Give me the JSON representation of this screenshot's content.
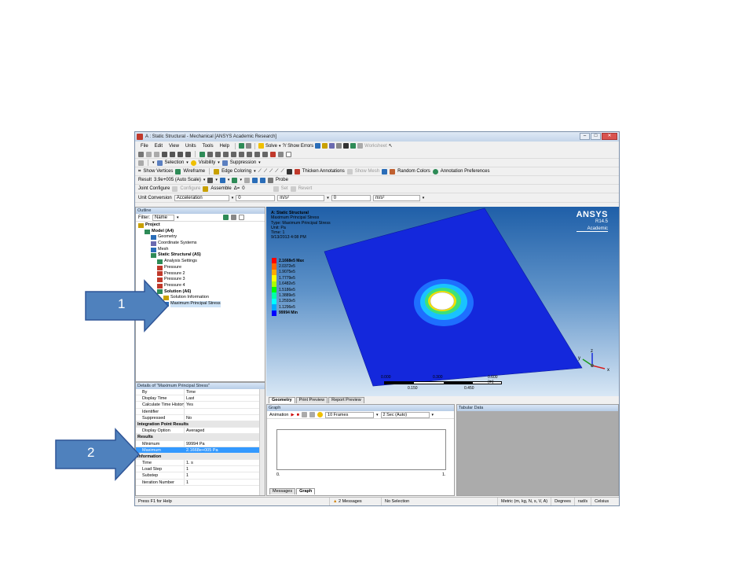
{
  "window": {
    "title": "A : Static Structural - Mechanical [ANSYS Academic Research]",
    "min": "–",
    "max": "□",
    "close": "✕"
  },
  "menu": [
    "File",
    "Edit",
    "View",
    "Units",
    "Tools",
    "Help"
  ],
  "toolbar1": {
    "solve": "Solve",
    "show_errors": "?/ Show Errors",
    "worksheet": "Worksheet"
  },
  "toolbar3": {
    "selection": "Selection",
    "visibility": "Visibility",
    "suppression": "Suppression"
  },
  "toolbar4": {
    "show_vertices": "Show Vertices",
    "wireframe": "Wireframe",
    "edge_coloring": "Edge Coloring",
    "thicken": "Thicken Annotations",
    "show_mesh": "Show Mesh",
    "random_colors": "Random Colors",
    "annotation_prefs": "Annotation Preferences"
  },
  "toolbar5": {
    "result_label": "Result",
    "result_scale": "3.9e+005 (Auto Scale)",
    "probe": "Probe"
  },
  "toolbar6": {
    "joint_configure": "Joint Configure",
    "configure": "Configure",
    "assemble": "Assemble",
    "set": "Set",
    "revert": "Revert",
    "zero": "0"
  },
  "toolbar7": {
    "unit_conversion": "Unit Conversion",
    "quantity": "Acceleration",
    "value1": "0",
    "unit1": "m/s²",
    "value2": "0",
    "unit2": "m/s²"
  },
  "outline": {
    "title": "Outline",
    "filter_label": "Filter:",
    "filter_value": "Name",
    "tree": [
      {
        "label": "Project",
        "level": 0,
        "bold": true,
        "icon": "project-icon"
      },
      {
        "label": "Model (A4)",
        "level": 1,
        "bold": true,
        "icon": "model-icon"
      },
      {
        "label": "Geometry",
        "level": 2,
        "bold": false,
        "icon": "geometry-icon"
      },
      {
        "label": "Coordinate Systems",
        "level": 2,
        "bold": false,
        "icon": "coordinate-icon"
      },
      {
        "label": "Mesh",
        "level": 2,
        "bold": false,
        "icon": "mesh-icon"
      },
      {
        "label": "Static Structural (A5)",
        "level": 2,
        "bold": true,
        "icon": "static-structural-icon"
      },
      {
        "label": "Analysis Settings",
        "level": 3,
        "bold": false,
        "icon": "settings-icon"
      },
      {
        "label": "Pressure",
        "level": 3,
        "bold": false,
        "icon": "pressure-icon"
      },
      {
        "label": "Pressure 2",
        "level": 3,
        "bold": false,
        "icon": "pressure-icon"
      },
      {
        "label": "Pressure 3",
        "level": 3,
        "bold": false,
        "icon": "pressure-icon"
      },
      {
        "label": "Pressure 4",
        "level": 3,
        "bold": false,
        "icon": "pressure-icon"
      },
      {
        "label": "Solution (A6)",
        "level": 3,
        "bold": true,
        "icon": "solution-icon"
      },
      {
        "label": "Solution Information",
        "level": 4,
        "bold": false,
        "icon": "info-icon"
      },
      {
        "label": "Maximum Principal Stress",
        "level": 4,
        "bold": false,
        "icon": "result-icon",
        "selected": true
      }
    ]
  },
  "details": {
    "title": "Details of \"Maximum Principal Stress\"",
    "rows": [
      {
        "k": "By",
        "v": "Time",
        "type": "row"
      },
      {
        "k": "Display Time",
        "v": "Last",
        "type": "row"
      },
      {
        "k": "Calculate Time History",
        "v": "Yes",
        "type": "row"
      },
      {
        "k": "Identifier",
        "v": "",
        "type": "row"
      },
      {
        "k": "Suppressed",
        "v": "No",
        "type": "row"
      },
      {
        "k": "Integration Point Results",
        "v": "",
        "type": "group"
      },
      {
        "k": "Display Option",
        "v": "Averaged",
        "type": "row"
      },
      {
        "k": "Results",
        "v": "",
        "type": "group"
      },
      {
        "k": "Minimum",
        "v": "99994 Pa",
        "type": "row"
      },
      {
        "k": "Maximum",
        "v": "2.1668e+005 Pa",
        "type": "highlight"
      },
      {
        "k": "Information",
        "v": "",
        "type": "group"
      },
      {
        "k": "Time",
        "v": "1. s",
        "type": "row"
      },
      {
        "k": "Load Step",
        "v": "1",
        "type": "row"
      },
      {
        "k": "Substep",
        "v": "1",
        "type": "row"
      },
      {
        "k": "Iteration Number",
        "v": "1",
        "type": "row"
      }
    ]
  },
  "viewport": {
    "lines": [
      "A: Static Structural",
      "Maximum Principal Stress",
      "Type: Maximum Principal Stress",
      "Unit: Pa",
      "Time: 1",
      "9/13/2013 4:08 PM"
    ],
    "legend": [
      {
        "label": "2.1668e5 Max",
        "color": "#ff0000"
      },
      {
        "label": "2.0372e5",
        "color": "#ff6600"
      },
      {
        "label": "1.9075e5",
        "color": "#ffaa00"
      },
      {
        "label": "1.7779e5",
        "color": "#ffff00"
      },
      {
        "label": "1.6482e5",
        "color": "#aaff00"
      },
      {
        "label": "1.5186e5",
        "color": "#00ff00"
      },
      {
        "label": "1.3889e5",
        "color": "#00ffaa"
      },
      {
        "label": "1.2593e5",
        "color": "#00ffff"
      },
      {
        "label": "1.1296e5",
        "color": "#00aaff"
      },
      {
        "label": "99994 Min",
        "color": "#0000ff"
      }
    ],
    "brand": "ANSYS",
    "release": "R14.5",
    "edition": "Academic",
    "scale_labels": [
      "0.000",
      "0.300",
      "0.600 (m)",
      "0.150",
      "0.450"
    ],
    "triad": {
      "x": "x",
      "y": "y",
      "z": "z"
    }
  },
  "view_tabs": [
    "Geometry",
    "Print Preview",
    "Report Preview"
  ],
  "graph": {
    "title": "Graph",
    "animation": "Animation",
    "frames": "10 Frames",
    "duration": "2 Sec (Auto)",
    "x_start": "0.",
    "x_end": "1.",
    "tabs": [
      "Messages",
      "Graph"
    ]
  },
  "tabular": {
    "title": "Tabular Data"
  },
  "status": {
    "help": "Press F1 for Help",
    "messages": "2 Messages",
    "selection": "No Selection",
    "units": "Metric (m, kg, N, s, V, A)",
    "angle": "Degrees",
    "rate": "rad/s",
    "temp": "Celsius"
  },
  "callouts": {
    "one": "1",
    "two": "2"
  },
  "colors": {
    "accent_blue": "#3399ff",
    "callout_blue": "#4f81bd",
    "plate_blue": "#1226d8"
  }
}
